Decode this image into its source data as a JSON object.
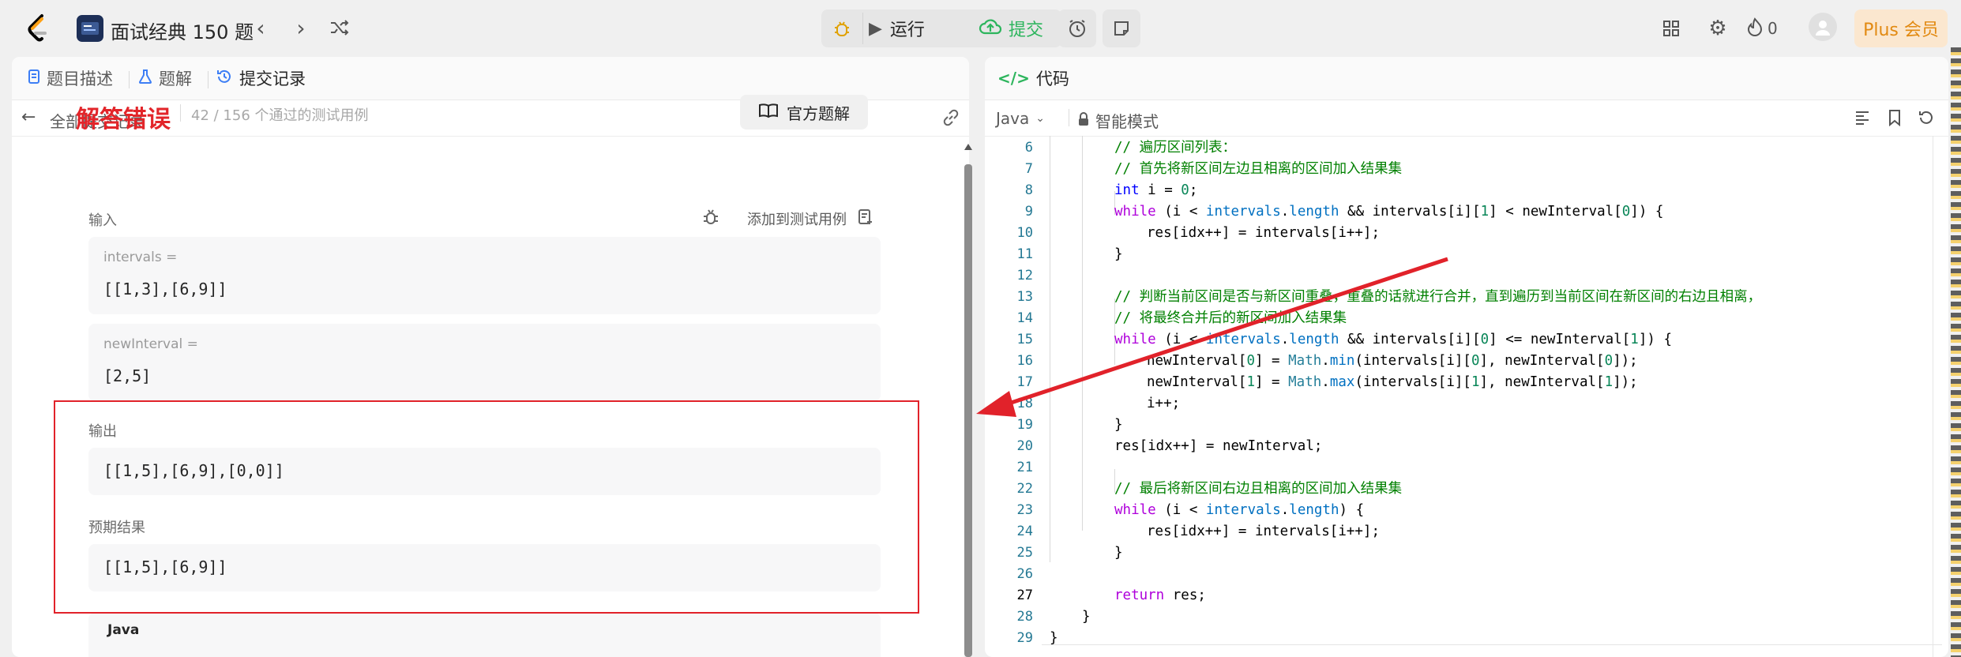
{
  "topbar": {
    "problem_list_title": "面试经典 150 题",
    "run_label": "运行",
    "submit_label": "提交",
    "fire_count": "0",
    "plus_label": "Plus 会员",
    "colors": {
      "submit_green": "#2db55d",
      "run_gray": "#262626",
      "plus_text": "#e28a12",
      "plus_bg": "#fbe7cf"
    }
  },
  "left_panel": {
    "tabs": [
      {
        "label": "题目描述",
        "icon": "description-icon"
      },
      {
        "label": "题解",
        "icon": "flask-icon"
      },
      {
        "label": "提交记录",
        "icon": "history-icon"
      }
    ],
    "back_label": "全部提交记录",
    "result": {
      "status": "解答错误",
      "counts": "42 / 156 个通过的测试用例",
      "solution_button": "官方题解",
      "input_label": "输入",
      "add_testcase_label": "添加到测试用例",
      "inputs": [
        {
          "name": "intervals =",
          "value": "[[1,3],[6,9]]"
        },
        {
          "name": "newInterval =",
          "value": "[2,5]"
        }
      ],
      "output_label": "输出",
      "output_value": "[[1,5],[6,9],[0,0]]",
      "expected_label": "预期结果",
      "expected_value": "[[1,5],[6,9]]",
      "language": "Java"
    }
  },
  "right_panel": {
    "tab_label": "代码",
    "language": "Java",
    "mode_label": "智能模式",
    "current_line": 27,
    "code_lines": [
      {
        "n": 6,
        "indent": 2,
        "tokens": [
          [
            "cm",
            "// 遍历区间列表："
          ]
        ]
      },
      {
        "n": 7,
        "indent": 2,
        "tokens": [
          [
            "cm",
            "// 首先将新区间左边且相离的区间加入结果集"
          ]
        ]
      },
      {
        "n": 8,
        "indent": 2,
        "tokens": [
          [
            "k",
            "int"
          ],
          [
            "t",
            " i = "
          ],
          [
            "num",
            "0"
          ],
          [
            "t",
            ";"
          ]
        ]
      },
      {
        "n": 9,
        "indent": 2,
        "tokens": [
          [
            "kc",
            "while"
          ],
          [
            "t",
            " (i < "
          ],
          [
            "v",
            "intervals"
          ],
          [
            "t",
            "."
          ],
          [
            "v",
            "length"
          ],
          [
            "t",
            " && intervals[i]["
          ],
          [
            "num",
            "1"
          ],
          [
            "t",
            "] < newInterval["
          ],
          [
            "num",
            "0"
          ],
          [
            "t",
            "]) {"
          ]
        ]
      },
      {
        "n": 10,
        "indent": 3,
        "tokens": [
          [
            "t",
            "res[idx++] = intervals[i++];"
          ]
        ]
      },
      {
        "n": 11,
        "indent": 2,
        "tokens": [
          [
            "t",
            "}"
          ]
        ]
      },
      {
        "n": 12,
        "indent": 0,
        "tokens": []
      },
      {
        "n": 13,
        "indent": 2,
        "tokens": [
          [
            "cm",
            "// 判断当前区间是否与新区间重叠，重叠的话就进行合并，直到遍历到当前区间在新区间的右边且相离，"
          ]
        ]
      },
      {
        "n": 14,
        "indent": 2,
        "tokens": [
          [
            "cm",
            "// 将最终合并后的新区间加入结果集"
          ]
        ]
      },
      {
        "n": 15,
        "indent": 2,
        "tokens": [
          [
            "kc",
            "while"
          ],
          [
            "t",
            " (i < "
          ],
          [
            "v",
            "intervals"
          ],
          [
            "t",
            "."
          ],
          [
            "v",
            "length"
          ],
          [
            "t",
            " && intervals[i]["
          ],
          [
            "num",
            "0"
          ],
          [
            "t",
            "] <= newInterval["
          ],
          [
            "num",
            "1"
          ],
          [
            "t",
            "]) {"
          ]
        ]
      },
      {
        "n": 16,
        "indent": 3,
        "tokens": [
          [
            "t",
            "newInterval["
          ],
          [
            "num",
            "0"
          ],
          [
            "t",
            "] = "
          ],
          [
            "typ",
            "Math"
          ],
          [
            "t",
            "."
          ],
          [
            "v",
            "min"
          ],
          [
            "t",
            "(intervals[i]["
          ],
          [
            "num",
            "0"
          ],
          [
            "t",
            "], newInterval["
          ],
          [
            "num",
            "0"
          ],
          [
            "t",
            "]);"
          ]
        ]
      },
      {
        "n": 17,
        "indent": 3,
        "tokens": [
          [
            "t",
            "newInterval["
          ],
          [
            "num",
            "1"
          ],
          [
            "t",
            "] = "
          ],
          [
            "typ",
            "Math"
          ],
          [
            "t",
            "."
          ],
          [
            "v",
            "max"
          ],
          [
            "t",
            "(intervals[i]["
          ],
          [
            "num",
            "1"
          ],
          [
            "t",
            "], newInterval["
          ],
          [
            "num",
            "1"
          ],
          [
            "t",
            "]);"
          ]
        ]
      },
      {
        "n": 18,
        "indent": 3,
        "tokens": [
          [
            "t",
            "i++;"
          ]
        ]
      },
      {
        "n": 19,
        "indent": 2,
        "tokens": [
          [
            "t",
            "}"
          ]
        ]
      },
      {
        "n": 20,
        "indent": 2,
        "tokens": [
          [
            "t",
            "res[idx++] = newInterval;"
          ]
        ]
      },
      {
        "n": 21,
        "indent": 0,
        "tokens": []
      },
      {
        "n": 22,
        "indent": 2,
        "tokens": [
          [
            "cm",
            "// 最后将新区间右边且相离的区间加入结果集"
          ]
        ]
      },
      {
        "n": 23,
        "indent": 2,
        "tokens": [
          [
            "kc",
            "while"
          ],
          [
            "t",
            " (i < "
          ],
          [
            "v",
            "intervals"
          ],
          [
            "t",
            "."
          ],
          [
            "v",
            "length"
          ],
          [
            "t",
            ") {"
          ]
        ]
      },
      {
        "n": 24,
        "indent": 3,
        "tokens": [
          [
            "t",
            "res[idx++] = intervals[i++];"
          ]
        ]
      },
      {
        "n": 25,
        "indent": 2,
        "tokens": [
          [
            "t",
            "}"
          ]
        ]
      },
      {
        "n": 26,
        "indent": 0,
        "tokens": []
      },
      {
        "n": 27,
        "indent": 2,
        "tokens": [
          [
            "kc",
            "return"
          ],
          [
            "t",
            " res;"
          ]
        ]
      },
      {
        "n": 28,
        "indent": 1,
        "tokens": [
          [
            "t",
            "}"
          ]
        ]
      },
      {
        "n": 29,
        "indent": 0,
        "tokens": [
          [
            "t",
            "}"
          ]
        ]
      }
    ]
  },
  "annotations": {
    "highlight_color": "#e1222a",
    "arrow_color": "#e1222a"
  }
}
